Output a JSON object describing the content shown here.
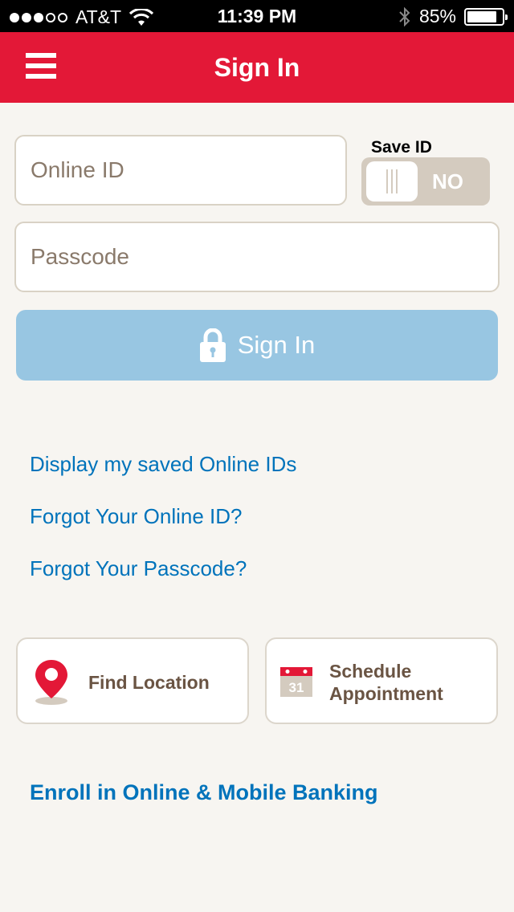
{
  "status_bar": {
    "carrier": "AT&T",
    "time": "11:39 PM",
    "battery": "85%",
    "battery_level": 0.85
  },
  "nav": {
    "title": "Sign In"
  },
  "form": {
    "online_id_placeholder": "Online ID",
    "passcode_placeholder": "Passcode",
    "save_id_label": "Save ID",
    "save_id_state": "NO",
    "signin_label": "Sign In"
  },
  "links": [
    "Display my saved Online IDs",
    "Forgot Your Online ID?",
    "Forgot Your Passcode?"
  ],
  "cards": {
    "find_location": "Find Location",
    "schedule_line1": "Schedule",
    "schedule_line2": "Appointment",
    "calendar_day": "31"
  },
  "enroll": "Enroll in Online & Mobile Banking",
  "colors": {
    "brand_red": "#e31837",
    "link_blue": "#0073bb",
    "button_blue": "#98c6e2",
    "background": "#f7f5f1"
  }
}
